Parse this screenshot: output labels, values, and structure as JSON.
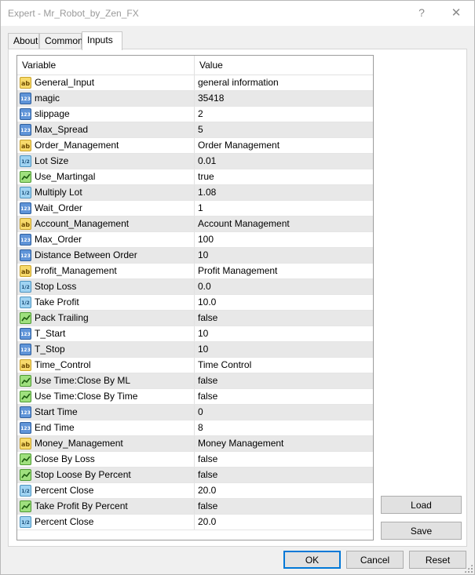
{
  "window": {
    "title": "Expert - Mr_Robot_by_Zen_FX",
    "help_glyph": "?",
    "close_glyph": "✕"
  },
  "tabs": [
    {
      "label": "About",
      "active": false
    },
    {
      "label": "Common",
      "active": false
    },
    {
      "label": "Inputs",
      "active": true
    }
  ],
  "table": {
    "headers": {
      "variable": "Variable",
      "value": "Value"
    },
    "rows": [
      {
        "type": "string",
        "name": "General_Input",
        "value": "general information"
      },
      {
        "type": "int",
        "name": "magic",
        "value": "35418"
      },
      {
        "type": "int",
        "name": "slippage",
        "value": "2"
      },
      {
        "type": "int",
        "name": "Max_Spread",
        "value": "5"
      },
      {
        "type": "string",
        "name": "Order_Management",
        "value": "Order Management"
      },
      {
        "type": "double",
        "name": "Lot Size",
        "value": "0.01"
      },
      {
        "type": "bool",
        "name": "Use_Martingal",
        "value": "true"
      },
      {
        "type": "double",
        "name": "Multiply Lot",
        "value": "1.08"
      },
      {
        "type": "int",
        "name": "Wait_Order",
        "value": "1"
      },
      {
        "type": "string",
        "name": "Account_Management",
        "value": "Account Management"
      },
      {
        "type": "int",
        "name": "Max_Order",
        "value": "100"
      },
      {
        "type": "int",
        "name": "Distance Between Order",
        "value": "10"
      },
      {
        "type": "string",
        "name": "Profit_Management",
        "value": "Profit Management"
      },
      {
        "type": "double",
        "name": "Stop Loss",
        "value": "0.0"
      },
      {
        "type": "double",
        "name": "Take Profit",
        "value": "10.0"
      },
      {
        "type": "bool",
        "name": "Pack Trailing",
        "value": "false"
      },
      {
        "type": "int",
        "name": "T_Start",
        "value": "10"
      },
      {
        "type": "int",
        "name": "T_Stop",
        "value": "10"
      },
      {
        "type": "string",
        "name": "Time_Control",
        "value": "Time Control"
      },
      {
        "type": "bool",
        "name": "Use Time:Close By ML",
        "value": "false"
      },
      {
        "type": "bool",
        "name": "Use Time:Close By Time",
        "value": "false"
      },
      {
        "type": "int",
        "name": "Start Time",
        "value": "0"
      },
      {
        "type": "int",
        "name": "End Time",
        "value": "8"
      },
      {
        "type": "string",
        "name": "Money_Management",
        "value": "Money Management"
      },
      {
        "type": "bool",
        "name": "Close By Loss",
        "value": "false"
      },
      {
        "type": "bool",
        "name": "Stop Loose By Percent",
        "value": "false"
      },
      {
        "type": "double",
        "name": "Percent Close",
        "value": "20.0"
      },
      {
        "type": "bool",
        "name": "Take Profit By Percent",
        "value": "false"
      },
      {
        "type": "double",
        "name": "Percent Close",
        "value": "20.0"
      }
    ]
  },
  "icons": {
    "string": {
      "name": "string-type-icon",
      "glyph": "ab"
    },
    "int": {
      "name": "integer-type-icon",
      "glyph": "123"
    },
    "double": {
      "name": "double-type-icon",
      "glyph": "1/2"
    },
    "bool": {
      "name": "boolean-type-icon",
      "glyph": ""
    }
  },
  "buttons": {
    "load": "Load",
    "save": "Save",
    "ok": "OK",
    "cancel": "Cancel",
    "reset": "Reset"
  }
}
